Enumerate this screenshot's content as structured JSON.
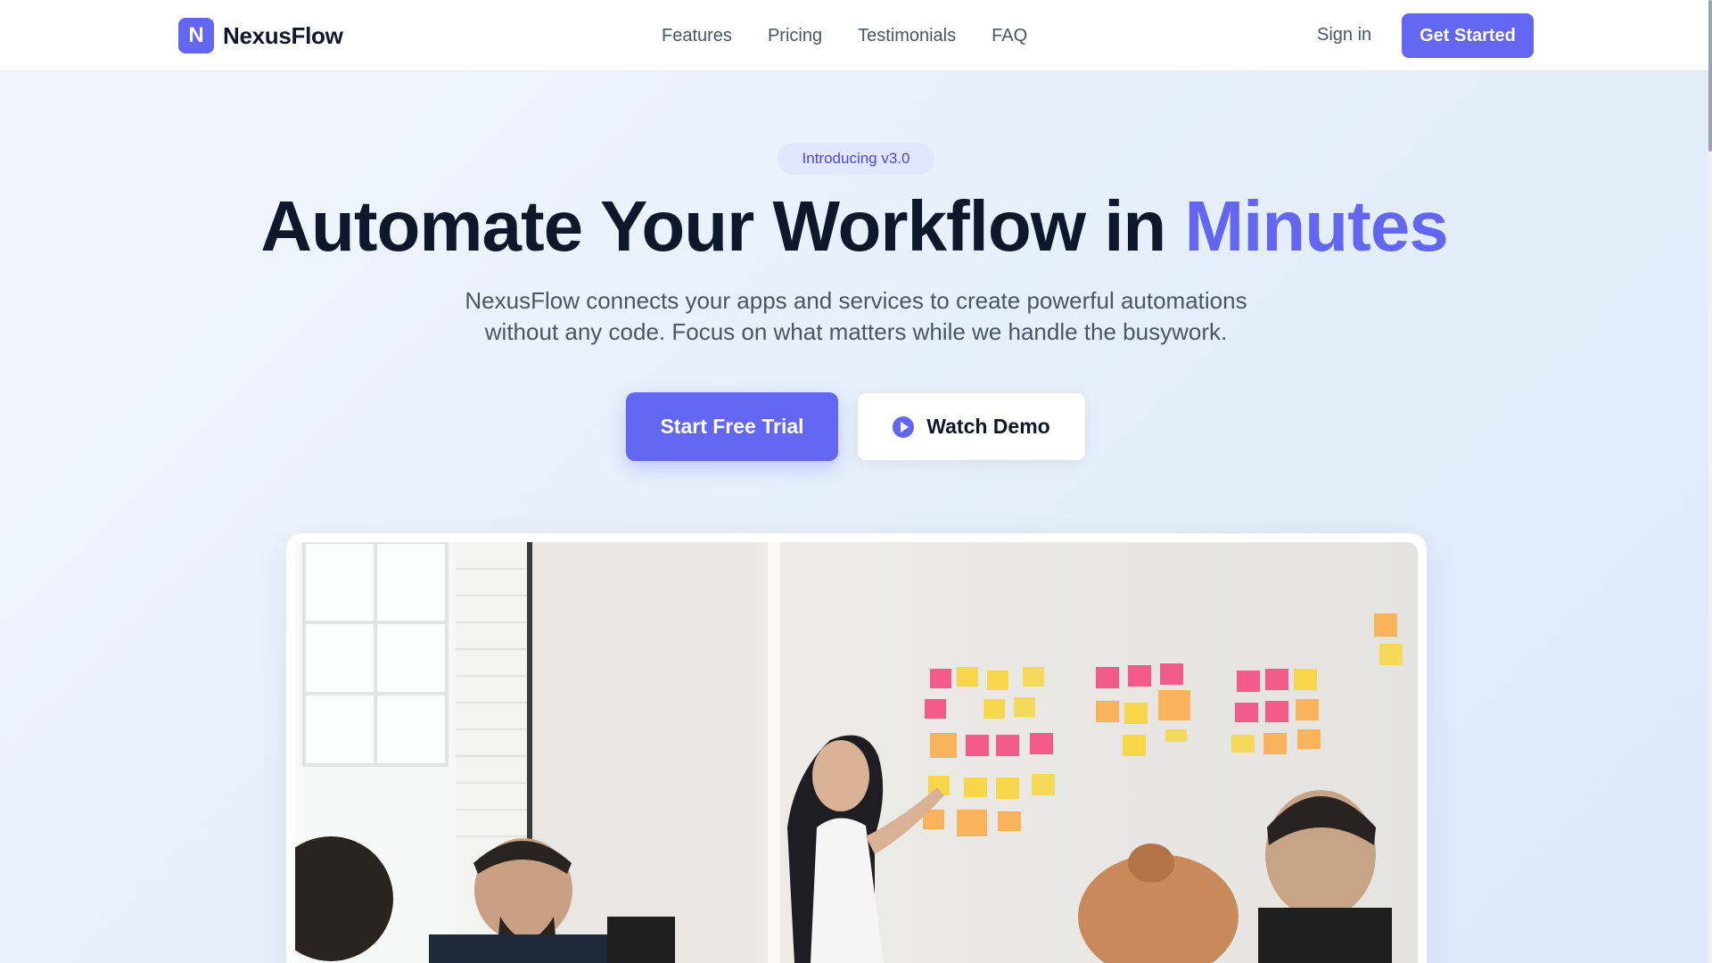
{
  "header": {
    "logo_letter": "N",
    "brand": "NexusFlow",
    "nav": [
      "Features",
      "Pricing",
      "Testimonials",
      "FAQ"
    ],
    "sign_in": "Sign in",
    "cta": "Get Started"
  },
  "hero": {
    "badge": "Introducing v3.0",
    "title_main": "Automate Your Workflow in ",
    "title_accent": "Minutes",
    "subtitle_line1": "NexusFlow connects your apps and services to create powerful automations",
    "subtitle_line2": "without any code. Focus on what matters while we handle the busywork.",
    "primary_button": "Start Free Trial",
    "secondary_button": "Watch Demo"
  },
  "icons": {
    "play": "play-circle-icon"
  },
  "colors": {
    "accent": "#6366f1",
    "heading": "#0f172a",
    "body_text": "#4b5563"
  }
}
